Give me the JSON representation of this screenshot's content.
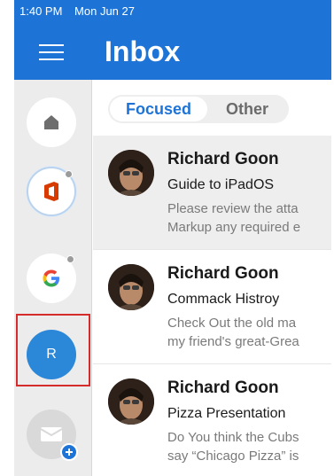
{
  "status_bar": {
    "time": "1:40 PM",
    "date": "Mon Jun 27"
  },
  "header": {
    "title": "Inbox",
    "menu_icon": "hamburger-menu-icon"
  },
  "colors": {
    "accent": "#1e74d6",
    "account_r": "#2b87d8",
    "selection_outline": "#d62b2b",
    "office_red": "#d83b01"
  },
  "sidebar": {
    "accounts": [
      {
        "id": "home",
        "icon": "home-icon"
      },
      {
        "id": "office",
        "icon": "office-icon"
      },
      {
        "id": "google",
        "icon": "google-icon"
      },
      {
        "id": "r",
        "initial": "R",
        "selected": true
      },
      {
        "id": "add-mail",
        "icon": "mail-add-icon"
      }
    ]
  },
  "tabs": {
    "focused": "Focused",
    "other": "Other"
  },
  "messages": [
    {
      "sender": "Richard Goon",
      "subject": "Guide to iPadOS",
      "preview_line1": "Please review the atta",
      "preview_line2": "Markup any required e"
    },
    {
      "sender": "Richard Goon",
      "subject": "Commack Histroy",
      "preview_line1": "Check Out the old ma",
      "preview_line2": "my friend's great-Grea"
    },
    {
      "sender": "Richard Goon",
      "subject": "Pizza Presentation",
      "preview_line1": "Do You think the Cubs",
      "preview_line2": "say “Chicago Pizza” is"
    }
  ]
}
